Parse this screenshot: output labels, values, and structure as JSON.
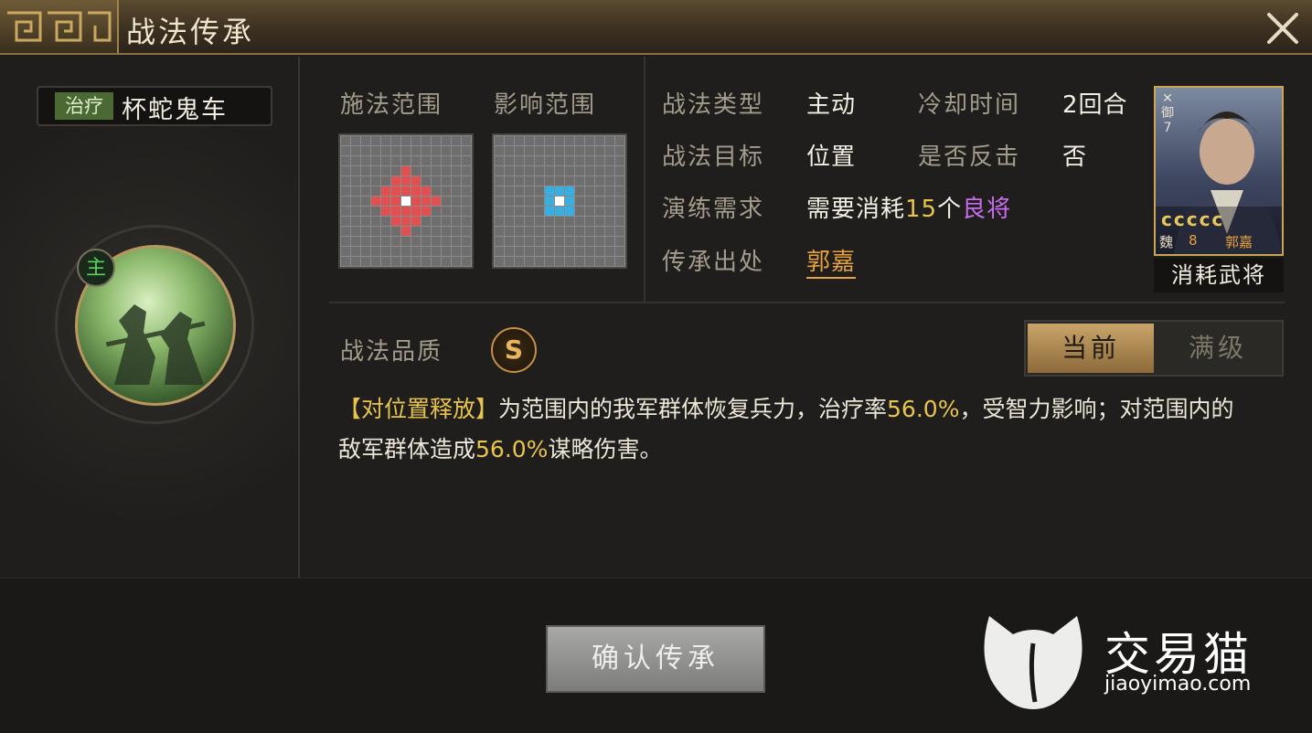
{
  "header": {
    "title": "战法传承"
  },
  "skill": {
    "tag": "治疗",
    "name": "杯蛇鬼车",
    "main_badge": "主",
    "quality_label": "战法品质",
    "quality_grade": "S"
  },
  "ranges": {
    "cast_label": "施法范围",
    "effect_label": "影响范围"
  },
  "info": {
    "type_label": "战法类型",
    "type_value": "主动",
    "cooldown_label": "冷却时间",
    "cooldown_value": "2回合",
    "target_label": "战法目标",
    "target_value": "位置",
    "counter_label": "是否反击",
    "counter_value": "否",
    "require_label": "演练需求",
    "require_prefix": "需要消耗",
    "require_count": "15",
    "require_unit": "个",
    "require_item": "良将",
    "source_label": "传承出处",
    "source_value": "郭嘉"
  },
  "general_card": {
    "faction": "魏",
    "cost": "8",
    "name": "郭嘉",
    "level": "7",
    "stars": "ccccc",
    "type_mark": "御",
    "caption": "消耗武将"
  },
  "tabs": {
    "current": "当前",
    "max": "满级"
  },
  "description": {
    "tag": "【对位置释放】",
    "text1": "为范围内的我军群体恢复兵力，治疗率",
    "rate1": "56.0%",
    "text2": "，受智力影响；对范围内的敌军群体造成",
    "rate2": "56.0%",
    "text3": "谋略伤害。"
  },
  "actions": {
    "confirm": "确认传承"
  },
  "watermark": {
    "brand": "交易猫",
    "url": "jiaoyimao.com"
  },
  "colors": {
    "accent_gold": "#c9a56a",
    "cast_red": "#e05050",
    "effect_blue": "#3aaee0",
    "highlight_yellow": "#e8c44c",
    "highlight_purple": "#c86cf0"
  }
}
